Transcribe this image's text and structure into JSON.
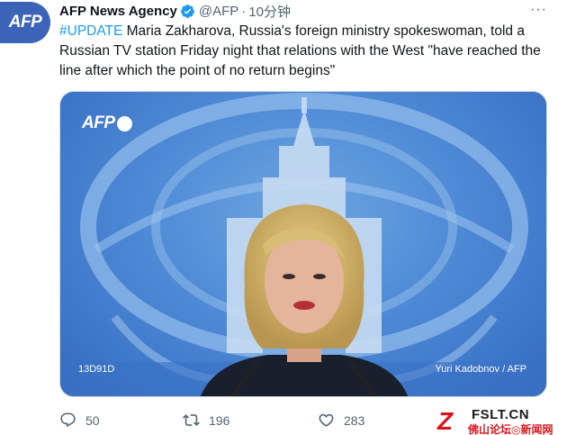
{
  "tweet": {
    "avatar_text": "AFP",
    "display_name": "AFP News Agency",
    "handle": "@AFP",
    "separator": "·",
    "time": "10分钟",
    "hashtag": "#UPDATE",
    "text": " Maria Zakharova, Russia's foreign ministry spokeswoman, told a Russian TV station Friday night that relations with the West \"have reached the line after which the point of no return begins\""
  },
  "media": {
    "logo_text": "AFP",
    "photo_id": "13D91D",
    "credit": "Yuri Kadobnov / AFP"
  },
  "actions": {
    "replies": "50",
    "retweets": "196",
    "likes": "283"
  },
  "watermark": {
    "top": "FSLT.CN",
    "bottom": "佛山论坛◎新闻网"
  },
  "colors": {
    "link": "#1d9bf0",
    "verified": "#1d9bf0",
    "muted": "#536471"
  }
}
